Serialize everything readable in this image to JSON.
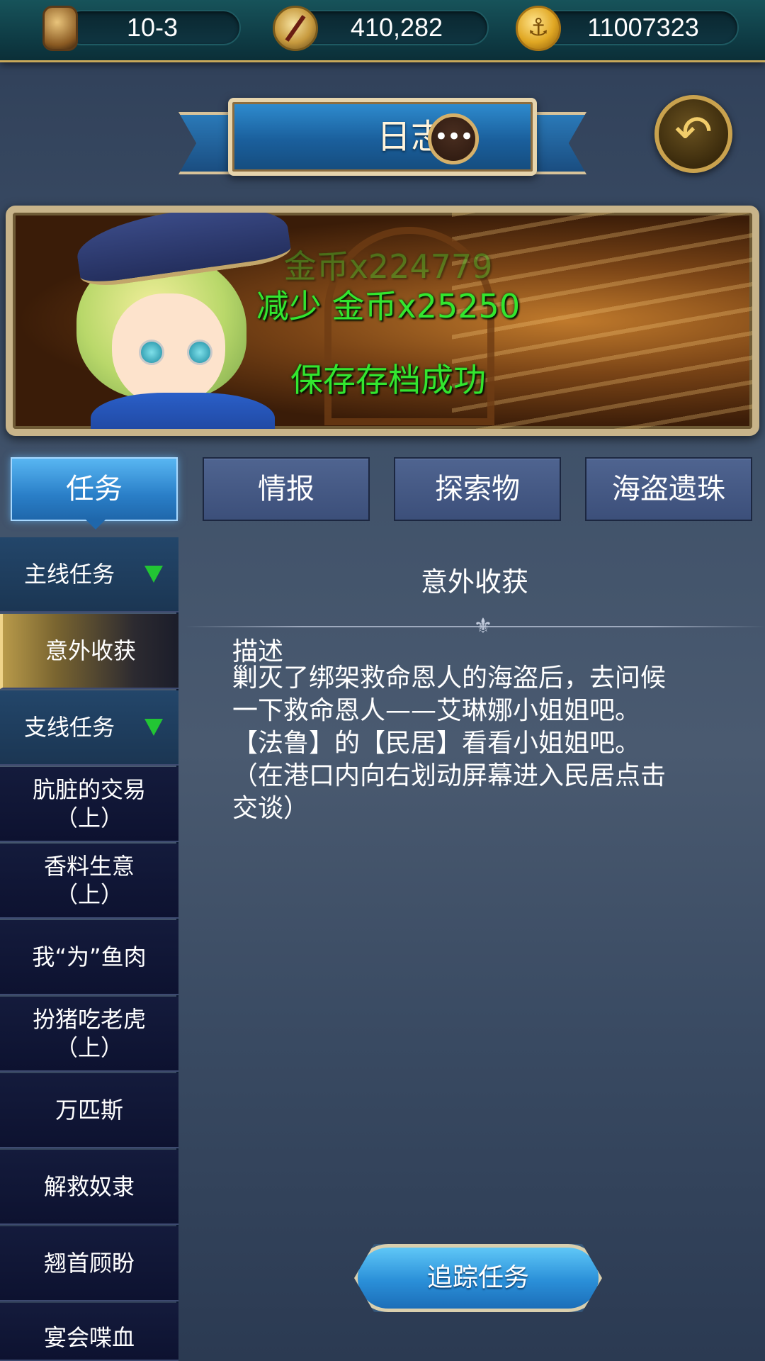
{
  "resources": {
    "level": "10-3",
    "compass_points": "410,282",
    "gold": "11007323",
    "icons": [
      "hourglass-icon",
      "compass-icon",
      "anchor-coin-icon"
    ]
  },
  "header": {
    "title": "日志",
    "chat_glyph": "•••",
    "back_glyph": "↶"
  },
  "notice": {
    "faded_message": "金币x224779",
    "message_1": "减少 金币x25250",
    "message_2": "保存存档成功",
    "color": "#33e62f"
  },
  "tabs": [
    {
      "label": "任务",
      "active": true
    },
    {
      "label": "情报",
      "active": false
    },
    {
      "label": "探索物",
      "active": false
    },
    {
      "label": "海盗遗珠",
      "active": false
    }
  ],
  "task_list": [
    {
      "label": "主线任务",
      "type": "category"
    },
    {
      "label": "意外收获",
      "type": "selected"
    },
    {
      "label": "支线任务",
      "type": "category"
    },
    {
      "label": "肮脏的交易\n（上）",
      "type": "item"
    },
    {
      "label": "香料生意\n（上）",
      "type": "item"
    },
    {
      "label": "我“为”鱼肉",
      "type": "item"
    },
    {
      "label": "扮猪吃老虎\n（上）",
      "type": "item"
    },
    {
      "label": "万匹斯",
      "type": "item"
    },
    {
      "label": "解救奴隶",
      "type": "item"
    },
    {
      "label": "翘首顾盼",
      "type": "item"
    },
    {
      "label": "宴会喋血",
      "type": "item"
    }
  ],
  "detail": {
    "title": "意外收获",
    "heading": "描述",
    "lines": [
      "剿灭了绑架救命恩人的海盗后，去问候",
      "一下救命恩人——艾琳娜小姐姐吧。",
      "【法鲁】的【民居】看看小姐姐吧。",
      "（在港口内向右划动屏幕进入民居点击",
      "交谈）"
    ]
  },
  "track_button": "追踪任务"
}
